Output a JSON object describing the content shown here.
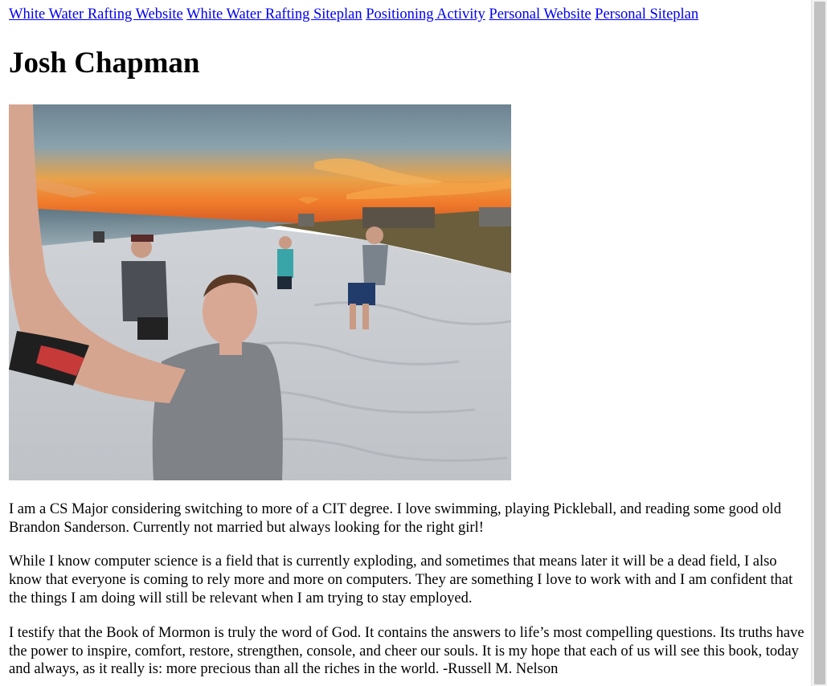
{
  "nav": {
    "links": [
      "White Water Rafting Website",
      "White Water Rafting Siteplan",
      "Positioning Activity",
      "Personal Website",
      "Personal Siteplan"
    ]
  },
  "header": {
    "title": "Josh Chapman"
  },
  "photo": {
    "icon": "beach-selfie-photo"
  },
  "main": {
    "paragraphs": [
      "I am a CS Major considering switching to more of a CIT degree. I love swimming, playing Pickleball, and reading some good old Brandon Sanderson. Currently not married but always looking for the right girl!",
      "While I know computer science is a field that is currently exploding, and sometimes that means later it will be a dead field, I also know that everyone is coming to rely more and more on computers. They are something I love to work with and I am confident that the things I am doing will still be relevant when I am trying to stay employed.",
      "I testify that the Book of Mormon is truly the word of God. It contains the answers to life’s most compelling questions. Its truths have the power to inspire, comfort, restore, strengthen, console, and cheer our souls. It is my hope that each of us will see this book, today and always, as it really is: more precious than all the riches in the world. -Russell M. Nelson"
    ]
  },
  "colors": {
    "link": "#0000ee",
    "text": "#000000",
    "background": "#ffffff"
  }
}
